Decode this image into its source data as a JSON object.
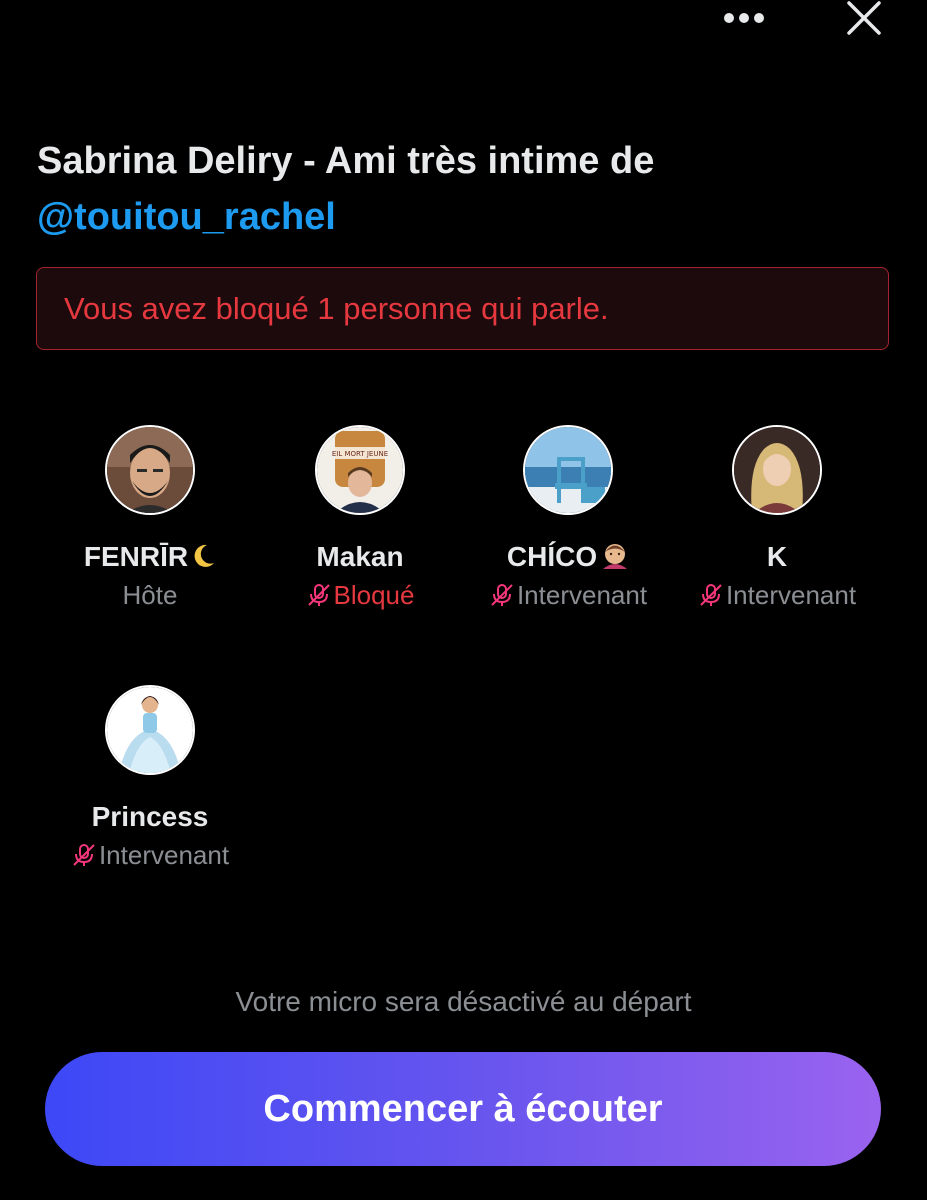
{
  "header": {
    "more_icon": "more-horizontal-icon",
    "close_icon": "close-icon"
  },
  "space": {
    "title": "Sabrina Deliry - Ami très intime de",
    "handle": "@touitou_rachel"
  },
  "alert": {
    "text": "Vous avez bloqué 1 personne qui parle.",
    "color": "#e5383f"
  },
  "speakers": [
    {
      "name": "FENRĪR",
      "role": "Hôte",
      "mic_muted": false,
      "icon": "moon-icon"
    },
    {
      "name": "Makan",
      "role": "Bloqué",
      "mic_muted": true,
      "blocked": true
    },
    {
      "name": "CHÍCO",
      "role": "Intervenant",
      "mic_muted": true,
      "icon": "face-emoji-icon"
    },
    {
      "name": "K",
      "role": "Intervenant",
      "mic_muted": true
    },
    {
      "name": "Princess",
      "role": "Intervenant",
      "mic_muted": true
    }
  ],
  "footer": {
    "notice": "Votre micro sera désactivé au départ",
    "listen_button": "Commencer à écouter"
  },
  "colors": {
    "background": "#000000",
    "accent_link": "#1d9bf0",
    "muted_mic": "#f4367a",
    "button_gradient_start": "#3d48f6",
    "button_gradient_end": "#9a63ef"
  }
}
